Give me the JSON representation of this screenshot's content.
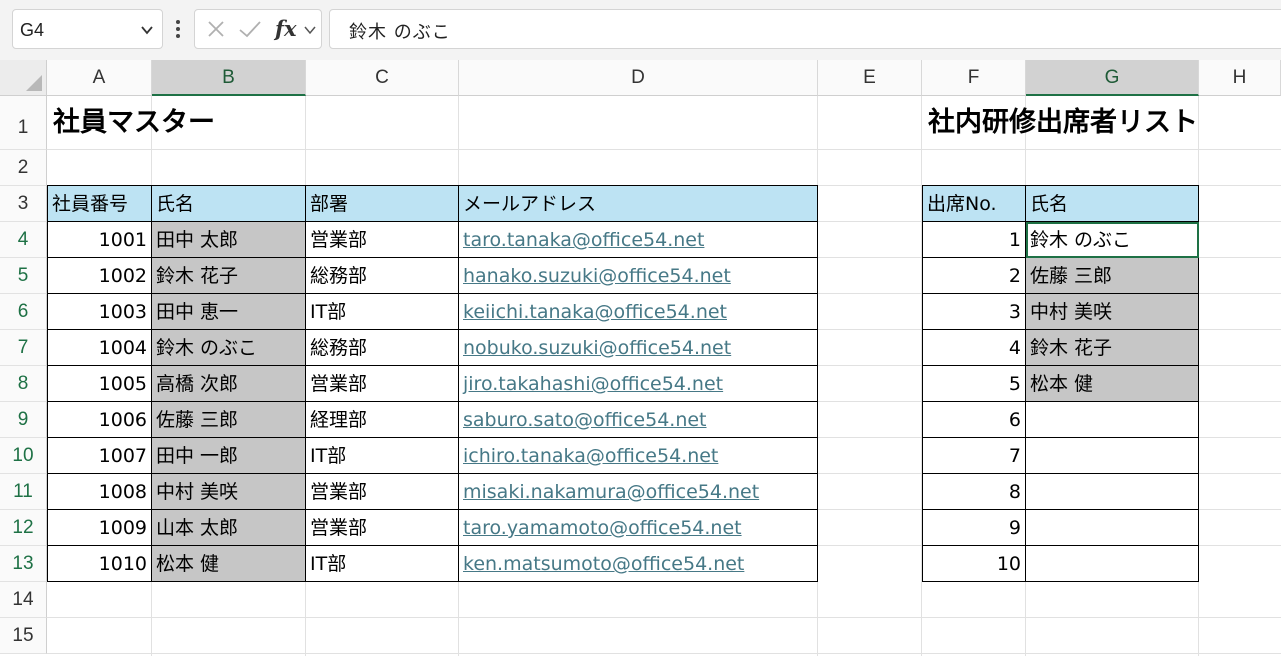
{
  "name_box": "G4",
  "formula_value": "鈴木 のぶこ",
  "fx_label": "fx",
  "columns": [
    "A",
    "B",
    "C",
    "D",
    "E",
    "F",
    "G",
    "H"
  ],
  "rows": [
    "1",
    "2",
    "3",
    "4",
    "5",
    "6",
    "7",
    "8",
    "9",
    "10",
    "11",
    "12",
    "13",
    "14",
    "15"
  ],
  "master": {
    "title": "社員マスター",
    "headers": [
      "社員番号",
      "氏名",
      "部署",
      "メールアドレス"
    ],
    "records": [
      {
        "id": "1001",
        "name": "田中 太郎",
        "dept": "営業部",
        "email": "taro.tanaka@office54.net"
      },
      {
        "id": "1002",
        "name": "鈴木 花子",
        "dept": "総務部",
        "email": "hanako.suzuki@office54.net"
      },
      {
        "id": "1003",
        "name": "田中 恵一",
        "dept": "IT部",
        "email": "keiichi.tanaka@office54.net"
      },
      {
        "id": "1004",
        "name": "鈴木 のぶこ",
        "dept": "総務部",
        "email": "nobuko.suzuki@office54.net"
      },
      {
        "id": "1005",
        "name": "高橋 次郎",
        "dept": "営業部",
        "email": "jiro.takahashi@office54.net"
      },
      {
        "id": "1006",
        "name": "佐藤 三郎",
        "dept": "経理部",
        "email": "saburo.sato@office54.net"
      },
      {
        "id": "1007",
        "name": "田中 一郎",
        "dept": "IT部",
        "email": "ichiro.tanaka@office54.net"
      },
      {
        "id": "1008",
        "name": "中村 美咲",
        "dept": "営業部",
        "email": "misaki.nakamura@office54.net"
      },
      {
        "id": "1009",
        "name": "山本 太郎",
        "dept": "営業部",
        "email": "taro.yamamoto@office54.net"
      },
      {
        "id": "1010",
        "name": "松本 健",
        "dept": "IT部",
        "email": "ken.matsumoto@office54.net"
      }
    ]
  },
  "attendance": {
    "title": "社内研修出席者リスト",
    "headers": [
      "出席No.",
      "氏名"
    ],
    "records": [
      {
        "no": "1",
        "name": "鈴木 のぶこ"
      },
      {
        "no": "2",
        "name": "佐藤 三郎"
      },
      {
        "no": "3",
        "name": "中村 美咲"
      },
      {
        "no": "4",
        "name": "鈴木 花子"
      },
      {
        "no": "5",
        "name": "松本 健"
      },
      {
        "no": "6",
        "name": ""
      },
      {
        "no": "7",
        "name": ""
      },
      {
        "no": "8",
        "name": ""
      },
      {
        "no": "9",
        "name": ""
      },
      {
        "no": "10",
        "name": ""
      }
    ]
  },
  "colors": {
    "header_fill": "#bde3f3",
    "highlight_fill": "#c6c6c6",
    "link": "#467886",
    "selection": "#1e7145"
  }
}
